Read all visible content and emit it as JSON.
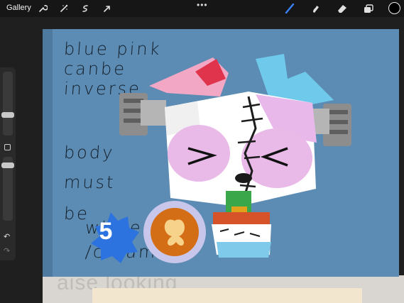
{
  "toolbar": {
    "gallery_label": "Gallery",
    "more_glyph": "•••",
    "tools_left": [
      "wrench-icon",
      "magic-wand-icon",
      "selection-icon",
      "transform-arrow-icon"
    ],
    "tools_right": [
      "brush-icon",
      "smudge-icon",
      "eraser-icon",
      "layers-icon"
    ],
    "current_color": "#000000",
    "active_tool_color": "#3b82f6"
  },
  "sidebar": {
    "undo_glyph": "↶",
    "redo_glyph": "↷"
  },
  "canvas": {
    "background_color": "#5c8cb4",
    "notes": [
      "blue pink",
      "canbe",
      "inverse",
      "body",
      "must",
      "be",
      "white",
      "/cream"
    ],
    "level_badge": "5",
    "character": "pink and white stitched panda-dog with bolts, squinting eyes",
    "underlay_text": "aise looking"
  }
}
